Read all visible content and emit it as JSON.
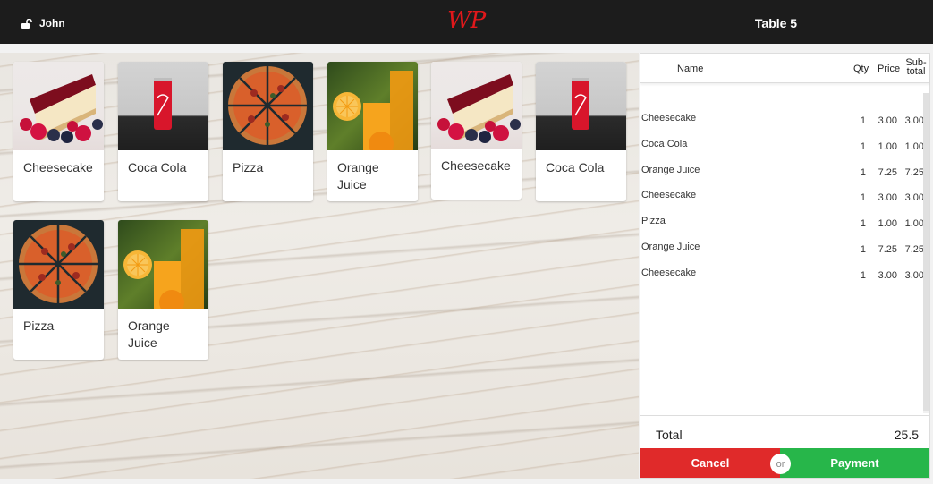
{
  "topbar": {
    "user_name": "John",
    "logo_text": "WP",
    "table_label": "Table 5"
  },
  "menu_items": [
    {
      "name": "Cheesecake",
      "image": "cheesecake-photo"
    },
    {
      "name": "Coca Cola",
      "image": "coca-cola-photo"
    },
    {
      "name": "Pizza",
      "image": "pizza-photo"
    },
    {
      "name": "Orange Juice",
      "image": "orange-juice-photo"
    },
    {
      "name": "Cheesecake",
      "image": "cheesecake-photo"
    },
    {
      "name": "Coca Cola",
      "image": "coca-cola-photo"
    },
    {
      "name": "Pizza",
      "image": "pizza-photo"
    },
    {
      "name": "Orange Juice",
      "image": "orange-juice-photo"
    }
  ],
  "order": {
    "headers": {
      "name": "Name",
      "qty": "Qty",
      "price": "Price",
      "subtotal_line1": "Sub-",
      "subtotal_line2": "total"
    },
    "rows": [
      {
        "name": "Cheesecake",
        "qty": "1",
        "price": "3.00",
        "subtotal": "3.00"
      },
      {
        "name": "Coca Cola",
        "qty": "1",
        "price": "1.00",
        "subtotal": "1.00"
      },
      {
        "name": "Orange Juice",
        "qty": "1",
        "price": "7.25",
        "subtotal": "7.25"
      },
      {
        "name": "Cheesecake",
        "qty": "1",
        "price": "3.00",
        "subtotal": "3.00"
      },
      {
        "name": "Pizza",
        "qty": "1",
        "price": "1.00",
        "subtotal": "1.00"
      },
      {
        "name": "Orange Juice",
        "qty": "1",
        "price": "7.25",
        "subtotal": "7.25"
      },
      {
        "name": "Cheesecake",
        "qty": "1",
        "price": "3.00",
        "subtotal": "3.00"
      }
    ],
    "total_label": "Total",
    "total_value": "25.5"
  },
  "actions": {
    "cancel_label": "Cancel",
    "or_label": "or",
    "payment_label": "Payment"
  },
  "colors": {
    "topbar": "#1c1c1c",
    "logo": "#e0181b",
    "cancel": "#e02a2a",
    "payment": "#27b64a"
  }
}
